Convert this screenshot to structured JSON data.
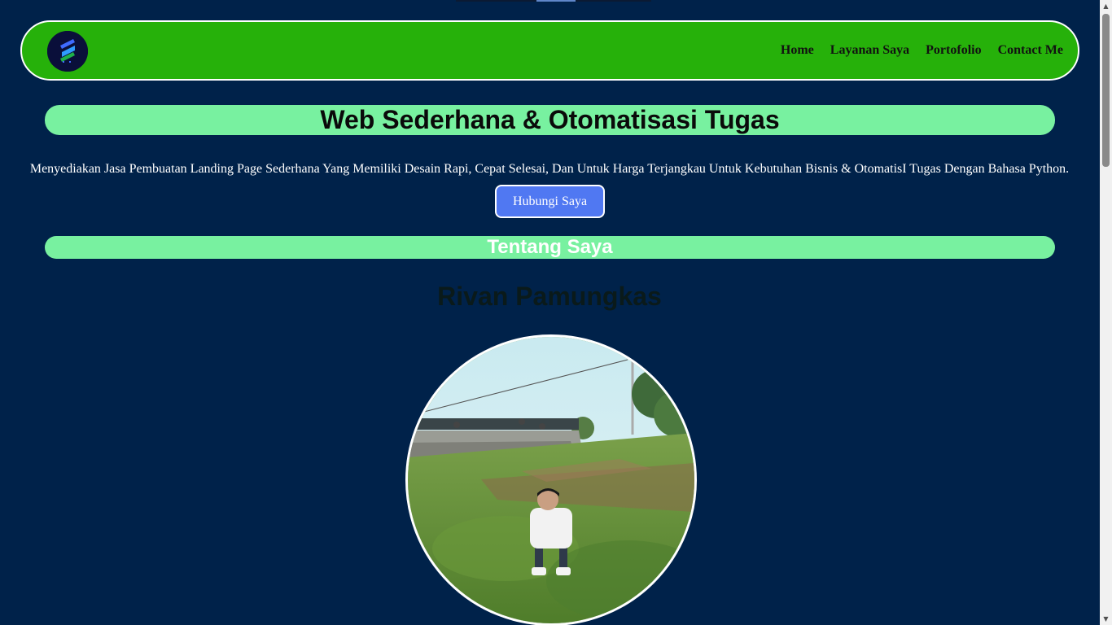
{
  "nav": {
    "logo": "site-logo",
    "links": [
      "Home",
      "Layanan Saya",
      "Portofolio",
      "Contact Me"
    ]
  },
  "hero": {
    "title": "Web Sederhana & Otomatisasi Tugas",
    "description": "Menyediakan Jasa Pembuatan Landing Page Sederhana Yang Memiliki Desain Rapi, Cepat Selesai, Dan Untuk Harga Terjangkau Untuk Kebutuhan Bisnis & OtomatisI Tugas Dengan Bahasa Python.",
    "cta_label": "Hubungi Saya"
  },
  "about": {
    "title": "Tentang Saya",
    "name": "Rivan Pamungkas"
  },
  "colors": {
    "background": "#00224a",
    "navbar": "#26b10a",
    "pill": "#78f1a0",
    "button": "#5078f2"
  }
}
